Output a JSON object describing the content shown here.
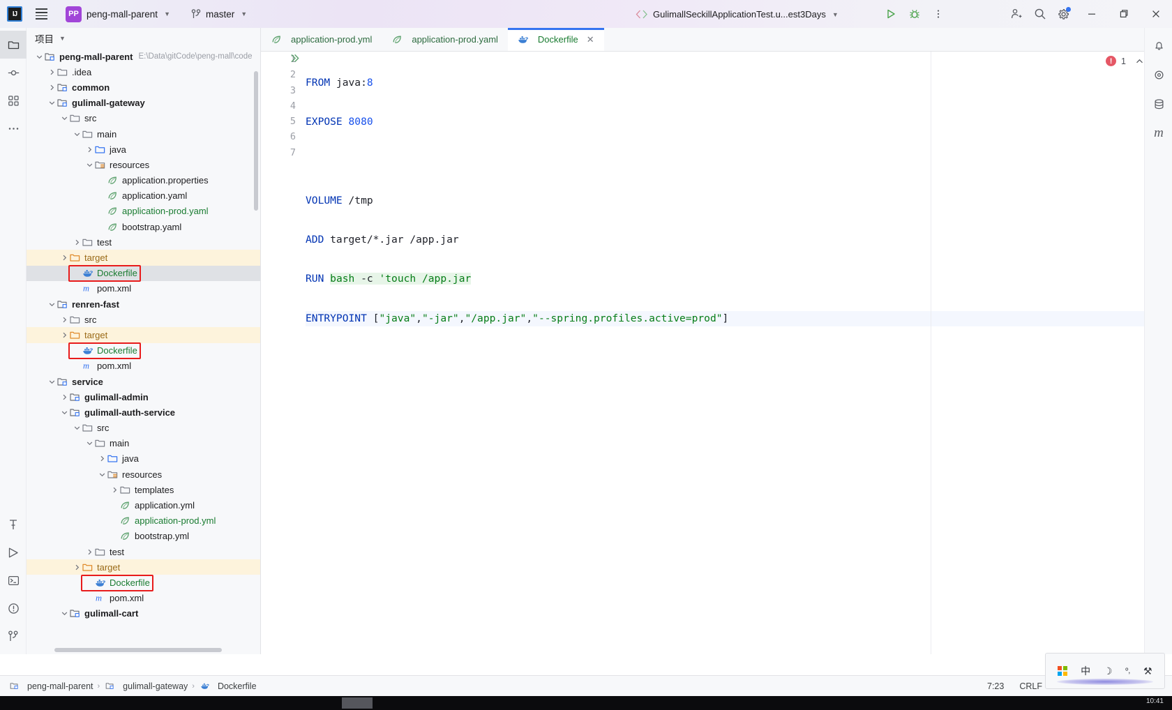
{
  "titlebar": {
    "ide_logo": "intellij-idea-logo",
    "ide_initials": "IJ",
    "project_badge": "PP",
    "project_name": "peng-mall-parent",
    "branch_name": "master",
    "run_config": "GulimallSeckillApplicationTest.u...est3Days",
    "buttons": {
      "run": "run-button",
      "debug": "debug-button",
      "more": "more-options-button",
      "add_user": "add-user-button",
      "search": "search-everywhere-button",
      "settings": "settings-button",
      "minimize": "minimize-button",
      "maximize": "maximize-button",
      "close": "close-button"
    }
  },
  "left_rail": {
    "items": [
      {
        "name": "project-tool-window",
        "icon": "folder-icon",
        "active": true
      },
      {
        "name": "commit-tool-window",
        "icon": "commit-icon",
        "active": false
      },
      {
        "name": "structure-tool-window",
        "icon": "structure-icon",
        "active": false
      },
      {
        "name": "more-tool-windows",
        "icon": "ellipsis-icon",
        "active": false
      }
    ],
    "bottom_items": [
      {
        "name": "build-tool-window",
        "icon": "hammer-icon"
      },
      {
        "name": "services-tool-window",
        "icon": "play-circle-icon"
      },
      {
        "name": "terminal-tool-window",
        "icon": "terminal-icon"
      },
      {
        "name": "problems-tool-window",
        "icon": "warning-circle-icon"
      },
      {
        "name": "git-tool-window",
        "icon": "git-branch-icon"
      }
    ]
  },
  "right_rail": {
    "items": [
      {
        "name": "notifications",
        "icon": "bell-icon"
      },
      {
        "name": "ai-assistant",
        "icon": "ai-icon"
      },
      {
        "name": "database",
        "icon": "database-icon"
      },
      {
        "name": "maven",
        "icon": "maven-m-icon"
      }
    ]
  },
  "project_panel": {
    "title": "项目",
    "root_path": "E:\\Data\\gitCode\\peng-mall\\code",
    "tree": [
      {
        "depth": 0,
        "twist": "down",
        "icon": "module-icon",
        "label": "peng-mall-parent",
        "bold": true,
        "path": "E:\\Data\\gitCode\\peng-mall\\code"
      },
      {
        "depth": 1,
        "twist": "right",
        "icon": "folder-icon",
        "label": ".idea"
      },
      {
        "depth": 1,
        "twist": "right",
        "icon": "module-icon",
        "label": "common",
        "bold": true
      },
      {
        "depth": 1,
        "twist": "down",
        "icon": "module-icon",
        "label": "gulimall-gateway",
        "bold": true
      },
      {
        "depth": 2,
        "twist": "down",
        "icon": "folder-icon",
        "label": "src"
      },
      {
        "depth": 3,
        "twist": "down",
        "icon": "folder-icon",
        "label": "main"
      },
      {
        "depth": 4,
        "twist": "right",
        "icon": "source-folder-icon",
        "label": "java"
      },
      {
        "depth": 4,
        "twist": "down",
        "icon": "resource-folder-icon",
        "label": "resources"
      },
      {
        "depth": 5,
        "twist": "none",
        "icon": "spring-leaf-icon",
        "label": "application.properties"
      },
      {
        "depth": 5,
        "twist": "none",
        "icon": "spring-leaf-icon",
        "label": "application.yaml"
      },
      {
        "depth": 5,
        "twist": "none",
        "icon": "spring-leaf-icon",
        "label": "application-prod.yaml",
        "color": "green"
      },
      {
        "depth": 5,
        "twist": "none",
        "icon": "spring-leaf-icon",
        "label": "bootstrap.yaml"
      },
      {
        "depth": 3,
        "twist": "right",
        "icon": "folder-icon",
        "label": "test"
      },
      {
        "depth": 2,
        "twist": "right",
        "icon": "excluded-folder-icon",
        "label": "target",
        "color": "orange",
        "row_highlight": "target"
      },
      {
        "depth": 3,
        "twist": "none",
        "icon": "docker-icon",
        "label": "Dockerfile",
        "color": "green",
        "selected": true,
        "red_box": true
      },
      {
        "depth": 3,
        "twist": "none",
        "icon": "maven-m-icon",
        "label": "pom.xml"
      },
      {
        "depth": 1,
        "twist": "down",
        "icon": "module-icon",
        "label": "renren-fast",
        "bold": true
      },
      {
        "depth": 2,
        "twist": "right",
        "icon": "folder-icon",
        "label": "src"
      },
      {
        "depth": 2,
        "twist": "right",
        "icon": "excluded-folder-icon",
        "label": "target",
        "color": "orange",
        "row_highlight": "target"
      },
      {
        "depth": 3,
        "twist": "none",
        "icon": "docker-icon",
        "label": "Dockerfile",
        "color": "green",
        "red_box": true
      },
      {
        "depth": 3,
        "twist": "none",
        "icon": "maven-m-icon",
        "label": "pom.xml"
      },
      {
        "depth": 1,
        "twist": "down",
        "icon": "module-icon",
        "label": "service",
        "bold": true
      },
      {
        "depth": 2,
        "twist": "right",
        "icon": "module-icon",
        "label": "gulimall-admin",
        "bold": true
      },
      {
        "depth": 2,
        "twist": "down",
        "icon": "module-icon",
        "label": "gulimall-auth-service",
        "bold": true
      },
      {
        "depth": 3,
        "twist": "down",
        "icon": "folder-icon",
        "label": "src"
      },
      {
        "depth": 4,
        "twist": "down",
        "icon": "folder-icon",
        "label": "main"
      },
      {
        "depth": 5,
        "twist": "right",
        "icon": "source-folder-icon",
        "label": "java"
      },
      {
        "depth": 5,
        "twist": "down",
        "icon": "resource-folder-icon",
        "label": "resources"
      },
      {
        "depth": 6,
        "twist": "right",
        "icon": "folder-icon",
        "label": "templates"
      },
      {
        "depth": 6,
        "twist": "none",
        "icon": "spring-leaf-icon",
        "label": "application.yml"
      },
      {
        "depth": 6,
        "twist": "none",
        "icon": "spring-leaf-icon",
        "label": "application-prod.yml",
        "color": "green"
      },
      {
        "depth": 6,
        "twist": "none",
        "icon": "spring-leaf-icon",
        "label": "bootstrap.yml"
      },
      {
        "depth": 4,
        "twist": "right",
        "icon": "folder-icon",
        "label": "test"
      },
      {
        "depth": 3,
        "twist": "right",
        "icon": "excluded-folder-icon",
        "label": "target",
        "color": "orange",
        "row_highlight": "target"
      },
      {
        "depth": 4,
        "twist": "none",
        "icon": "docker-icon",
        "label": "Dockerfile",
        "color": "green",
        "red_box": true
      },
      {
        "depth": 4,
        "twist": "none",
        "icon": "maven-m-icon",
        "label": "pom.xml"
      },
      {
        "depth": 2,
        "twist": "down",
        "icon": "module-icon",
        "label": "gulimall-cart",
        "bold": true
      }
    ]
  },
  "editor": {
    "tabs": [
      {
        "label": "application-prod.yml",
        "icon": "spring-leaf-icon",
        "active": false,
        "closable": false
      },
      {
        "label": "application-prod.yaml",
        "icon": "spring-leaf-icon",
        "active": false,
        "closable": false
      },
      {
        "label": "Dockerfile",
        "icon": "docker-icon",
        "active": true,
        "closable": true
      }
    ],
    "close_glyph": "✕",
    "more_glyph": "⋮",
    "error_count": "1",
    "lines": [
      {
        "n": "1",
        "runmark": true
      },
      {
        "n": "2",
        "runmark": false
      },
      {
        "n": "3",
        "runmark": false
      },
      {
        "n": "4",
        "runmark": false
      },
      {
        "n": "5",
        "runmark": false
      },
      {
        "n": "6",
        "runmark": false
      },
      {
        "n": "7",
        "runmark": false
      }
    ],
    "code": {
      "l1_kw": "FROM",
      "l1_img": " java:",
      "l1_tag": "8",
      "l2_kw": "EXPOSE",
      "l2_port": "8080",
      "l3": "",
      "l4_kw": "VOLUME",
      "l4_arg": " /tmp",
      "l5_kw": "ADD",
      "l5_arg": " target/*.jar /app.jar",
      "l6_kw": "RUN",
      "l6_cmd": "bash",
      "l6_flag": " -c ",
      "l6_str": "'touch /app.jar",
      "l7_kw": "ENTRYPOINT",
      "l7_open": " [",
      "l7_a1": "\"java\"",
      "l7_c1": ",",
      "l7_a2": "\"-jar\"",
      "l7_c2": ",",
      "l7_a3": "\"/app.jar\"",
      "l7_c3": ",",
      "l7_a4": "\"--spring.profiles.active=prod\"",
      "l7_close": "]"
    }
  },
  "statusbar": {
    "breadcrumbs": [
      {
        "label": "peng-mall-parent",
        "icon": "module-icon"
      },
      {
        "label": "gulimall-gateway",
        "icon": "module-icon"
      },
      {
        "label": "Dockerfile",
        "icon": "docker-icon"
      }
    ],
    "separator": "›",
    "caret_position": "7:23",
    "line_separator": "CRLF"
  },
  "ime_popup": {
    "windows_logo": "windows-logo-icon",
    "language_mode": "中",
    "moon_icon": "moon-icon",
    "punctuation_icon": "punctuation-icon",
    "tools_icon": "tools-icon"
  },
  "taskbar": {
    "clock": "10:41"
  },
  "colors": {
    "accent_blue": "#3574f0",
    "docker_blue": "#3b7fd4",
    "green_text": "#197b30",
    "target_highlight": "#fdf3dc",
    "red_box": "#e81b1b",
    "selection": "#dfe1e5",
    "keyword": "#0033b3",
    "string": "#067d17"
  }
}
